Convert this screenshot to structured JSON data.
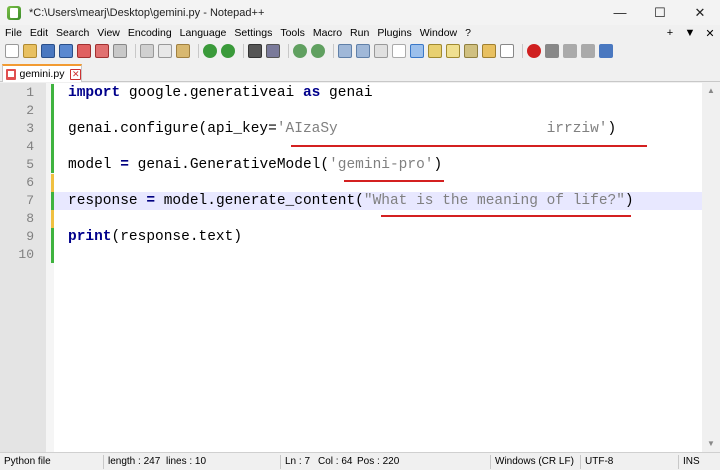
{
  "window": {
    "title": "*C:\\Users\\mearj\\Desktop\\gemini.py - Notepad++",
    "minimize": "—",
    "maximize": "☐",
    "close": "✕"
  },
  "menu": {
    "items": [
      "File",
      "Edit",
      "Search",
      "View",
      "Encoding",
      "Language",
      "Settings",
      "Tools",
      "Macro",
      "Run",
      "Plugins",
      "Window",
      "?"
    ],
    "right": [
      "+",
      "▼",
      "✕"
    ]
  },
  "tab": {
    "label": "gemini.py",
    "close": "✕"
  },
  "editor": {
    "lines": [
      {
        "num": "1"
      },
      {
        "num": "2"
      },
      {
        "num": "3"
      },
      {
        "num": "4"
      },
      {
        "num": "5"
      },
      {
        "num": "6"
      },
      {
        "num": "7"
      },
      {
        "num": "8"
      },
      {
        "num": "9"
      },
      {
        "num": "10"
      }
    ],
    "code": {
      "l1_kw1": "import",
      "l1_mid": " google.generativeai ",
      "l1_kw2": "as",
      "l1_end": " genai",
      "l3_a": "genai.configure(api_key=",
      "l3_str": "'AIzaSy                        irrziw'",
      "l3_b": ")",
      "l5_a": "model ",
      "l5_eq": "=",
      "l5_b": " genai.GenerativeModel(",
      "l5_str": "'gemini-pro'",
      "l5_c": ")",
      "l7_a": "response ",
      "l7_eq": "=",
      "l7_b": " model.generate_content(",
      "l7_str": "\"What is the meaning of life?\"",
      "l7_c": ")",
      "l9_kw": "print",
      "l9_b": "(response.text)"
    }
  },
  "status": {
    "filetype": "Python file",
    "length": "length : 247",
    "lines": "lines : 10",
    "ln": "Ln : 7",
    "col": "Col : 64",
    "pos": "Pos : 220",
    "eol": "Windows (CR LF)",
    "encoding": "UTF-8",
    "mode": "INS"
  }
}
